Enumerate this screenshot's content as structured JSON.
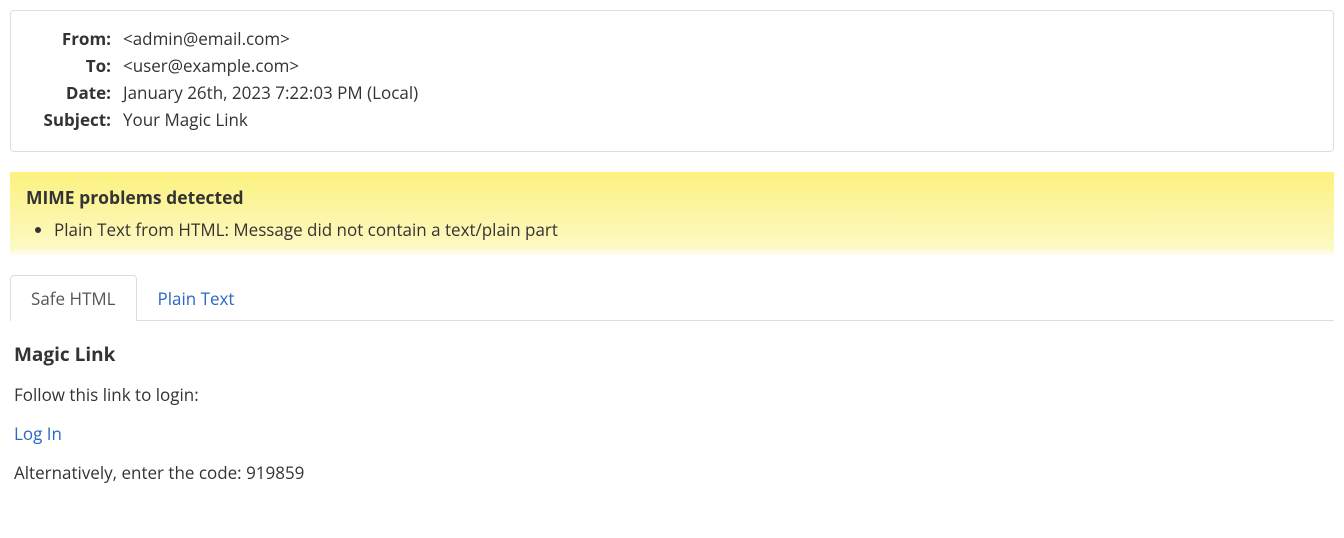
{
  "header": {
    "labels": {
      "from": "From:",
      "to": "To:",
      "date": "Date:",
      "subject": "Subject:"
    },
    "from": "<admin@email.com>",
    "to": "<user@example.com>",
    "date": "January 26th, 2023 7:22:03 PM (Local)",
    "subject": "Your Magic Link"
  },
  "mime": {
    "title": "MIME problems detected",
    "items": [
      "Plain Text from HTML: Message did not contain a text/plain part"
    ]
  },
  "tabs": {
    "safe_html": "Safe HTML",
    "plain_text": "Plain Text"
  },
  "body": {
    "heading": "Magic Link",
    "intro": "Follow this link to login:",
    "link_text": "Log In",
    "code_line": "Alternatively, enter the code: 919859"
  }
}
